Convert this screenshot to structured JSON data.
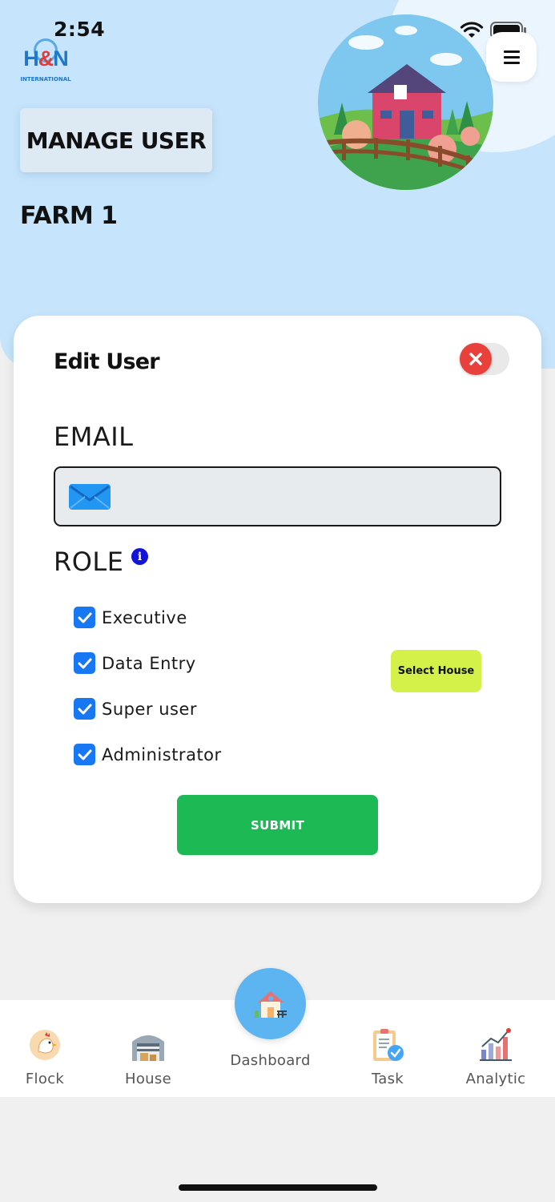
{
  "status_bar": {
    "time": "2:54"
  },
  "logo": {
    "brand_h": "H",
    "brand_amp": "&",
    "brand_n": "N",
    "subtitle": "INTERNATIONAL"
  },
  "header": {
    "manage_user_label": "MANAGE USER",
    "farm_name": "FARM 1"
  },
  "edit_user": {
    "title": "Edit User",
    "email_label": "EMAIL",
    "email_value": "",
    "role_label": "ROLE",
    "roles": [
      {
        "label": "Executive",
        "checked": true
      },
      {
        "label": "Data Entry",
        "checked": true
      },
      {
        "label": "Super user",
        "checked": true
      },
      {
        "label": "Administrator",
        "checked": true
      }
    ],
    "select_house_label": "Select House",
    "submit_label": "SUBMIT"
  },
  "tabbar": {
    "items": [
      {
        "label": "Flock",
        "icon": "chicken-icon"
      },
      {
        "label": "House",
        "icon": "barn-icon"
      },
      {
        "label": "Dashboard",
        "icon": "farmhouse-icon"
      },
      {
        "label": "Task",
        "icon": "clipboard-check-icon"
      },
      {
        "label": "Analytic",
        "icon": "bar-chart-icon"
      }
    ]
  },
  "colors": {
    "hero_bg": "#c6e4fb",
    "submit": "#1db954",
    "select_house": "#d4f149",
    "checkbox": "#1877f2",
    "close": "#e8403b"
  }
}
